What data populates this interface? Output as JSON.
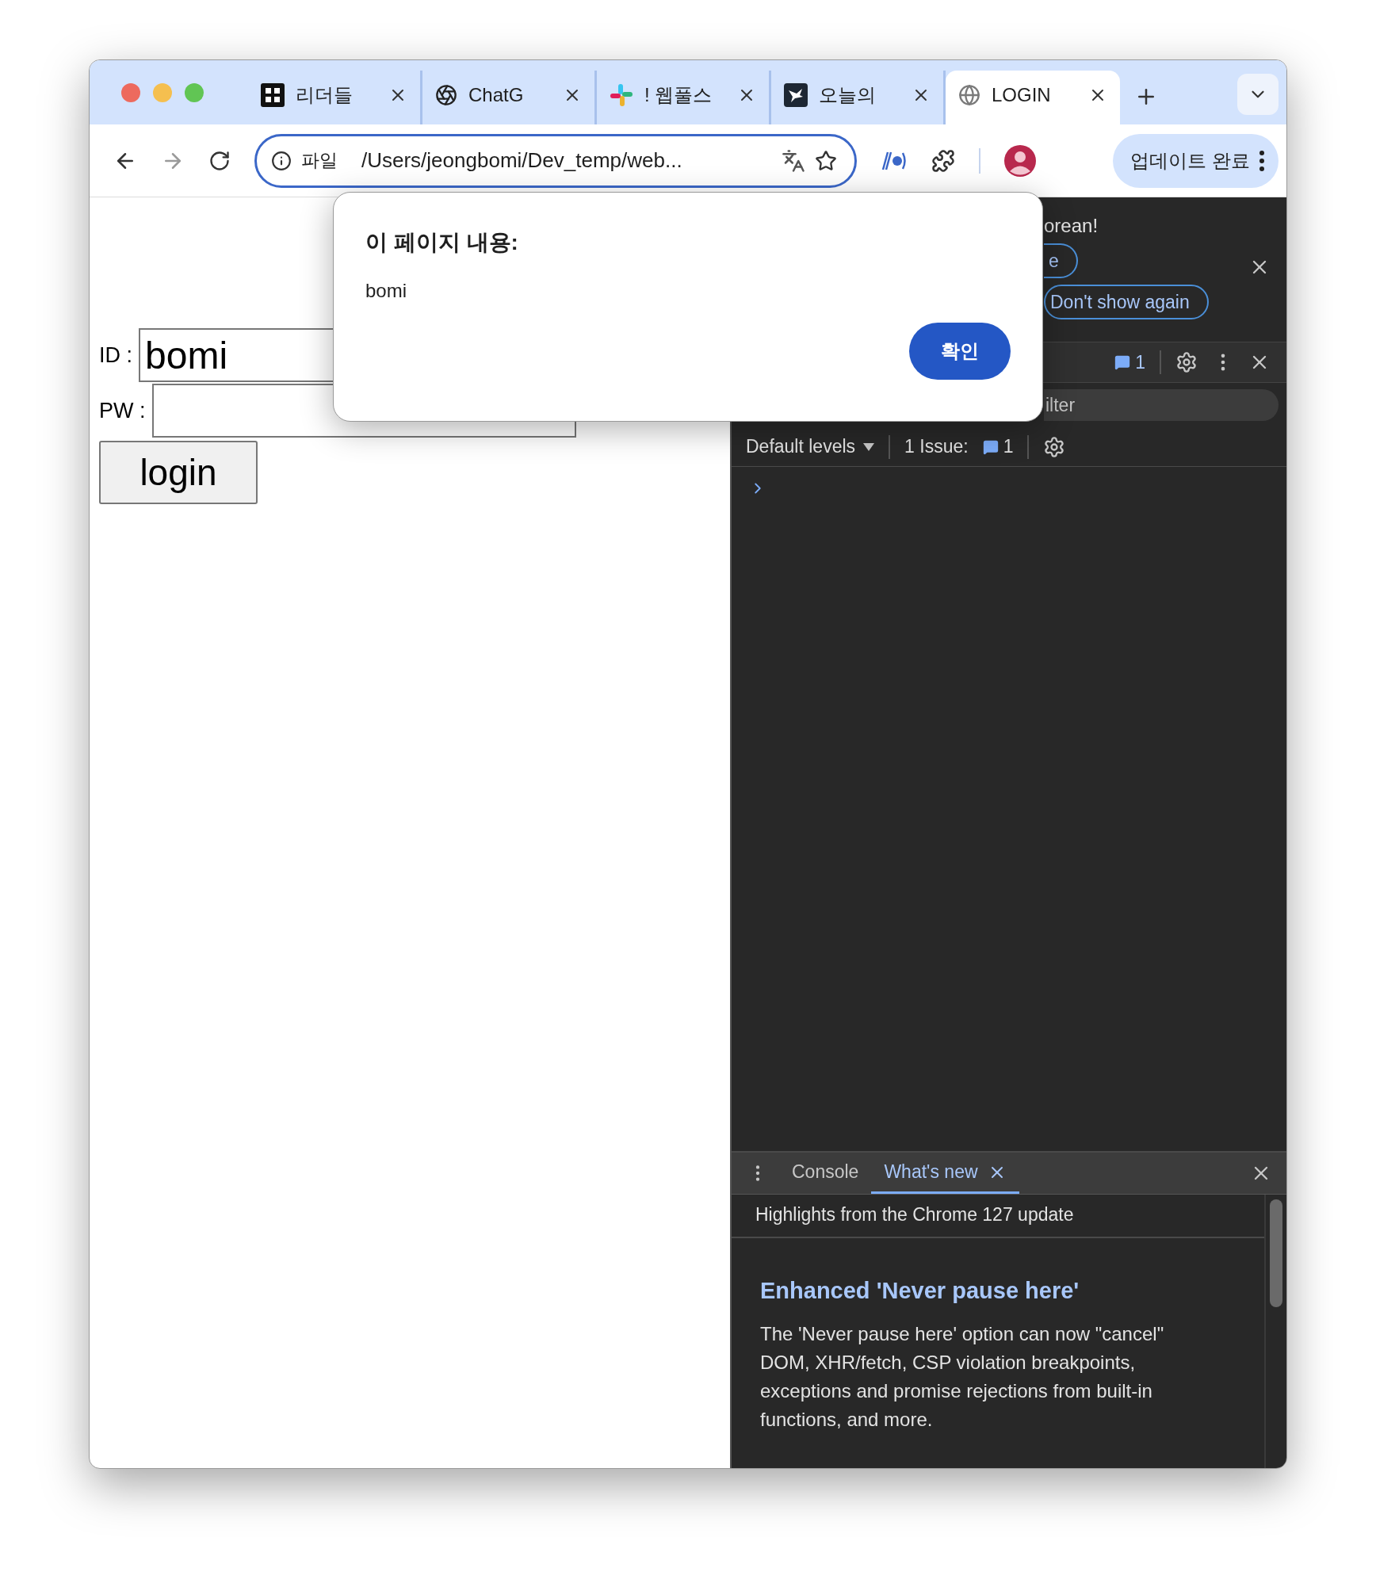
{
  "browser": {
    "tabs": [
      {
        "label": "리더들",
        "kind": "blocks",
        "selected": false
      },
      {
        "label": "ChatG",
        "kind": "aperture",
        "selected": false
      },
      {
        "label": "! 웹풀스",
        "kind": "pinwheel",
        "selected": false
      },
      {
        "label": "오늘의",
        "kind": "bird",
        "selected": false
      },
      {
        "label": "LOGIN",
        "kind": "globe",
        "selected": true
      }
    ],
    "address": {
      "scheme": "파일",
      "url": "/Users/jeongbomi/Dev_temp/web..."
    },
    "update_button": "업데이트 완료"
  },
  "page": {
    "id_label": "ID :",
    "id_value": "bomi",
    "pw_label": "PW :",
    "login_button": "login"
  },
  "dialog": {
    "title": "이 페이지 내용:",
    "message": "bomi",
    "ok_button": "확인"
  },
  "devtools": {
    "banner_text": "orean!",
    "banner_buttons": [
      "e",
      "Don't show again"
    ],
    "issues_count": "1",
    "filter_placeholder": "ilter",
    "levels": "Default levels",
    "issues_label": "1 Issue:",
    "issues_badge": "1",
    "drawer": {
      "tabs": [
        {
          "label": "Console",
          "selected": false,
          "closable": false
        },
        {
          "label": "What's new",
          "selected": true,
          "closable": true
        }
      ],
      "highlights": "Highlights from the Chrome 127 update",
      "heading": "Enhanced 'Never pause here'",
      "body": "The 'Never pause here' option can now \"cancel\" DOM, XHR/fetch, CSP violation breakpoints, exceptions and promise rejections from built-in functions, and more."
    }
  }
}
